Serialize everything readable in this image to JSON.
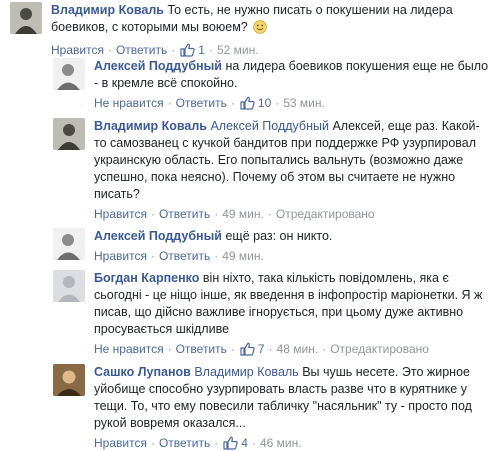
{
  "comments": [
    {
      "author": "Владимир Коваль",
      "mention": "",
      "text": "То есть, не нужно писать о покушении на лидера боевиков, с которыми мы воюем?",
      "emoji": "smile",
      "action1": "Нравится",
      "action2": "Ответить",
      "likes": "1",
      "time": "52 мин.",
      "edited": ""
    },
    {
      "author": "Алексей Поддубный",
      "mention": "",
      "text": "на лидера боевиков покушения еще не было - в кремле всё спокойно.",
      "action1": "Не нравится",
      "action2": "Ответить",
      "likes": "10",
      "time": "53 мин.",
      "edited": ""
    },
    {
      "author": "Владимир Коваль",
      "mention": "Алексей Поддубный",
      "text": "Алексей, еще раз. Какой-то самозванец с кучкой бандитов при поддержке РФ узурпировал украинскую область. Его попытались вальнуть (возможно даже успешно, пока неясно). Почему об этом вы считаете не нужно писать?",
      "action1": "Нравится",
      "action2": "Ответить",
      "likes": "",
      "time": "49 мин.",
      "edited": "Отредактировано"
    },
    {
      "author": "Алексей Поддубный",
      "mention": "",
      "text": "ещё раз: он никто.",
      "action1": "Нравится",
      "action2": "Ответить",
      "likes": "",
      "time": "49 мин.",
      "edited": ""
    },
    {
      "author": "Богдан Карпенко",
      "mention": "",
      "text": "він ніхто, така кількість повідомлень, яка є сьогодні - це ніщо інше, як введення в інфопростір маріонетки. Я ж писав, що дійсно важливе ігнорується, при цьому дуже активно просувається шкідливе",
      "action1": "Не нравится",
      "action2": "Ответить",
      "likes": "7",
      "time": "48 мин.",
      "edited": "Отредактировано"
    },
    {
      "author": "Сашко Лупанов",
      "mention": "Владимир Коваль",
      "text": "Вы чушь несете. Это жирное уйобище способно узурпировать власть разве что в курятнике у тещи. То, что ему повесили табличку \"насяльник\" ту - просто под рукой вовремя оказался...",
      "action1": "Нравится",
      "action2": "Ответить",
      "likes": "4",
      "time": "46 мин.",
      "edited": ""
    }
  ],
  "colors": {
    "link": "#3b5998",
    "meta": "#90949c",
    "text": "#1d2129"
  },
  "icons": {
    "like": "thumbs-up-icon",
    "emoji": "smile-emoji-icon"
  }
}
